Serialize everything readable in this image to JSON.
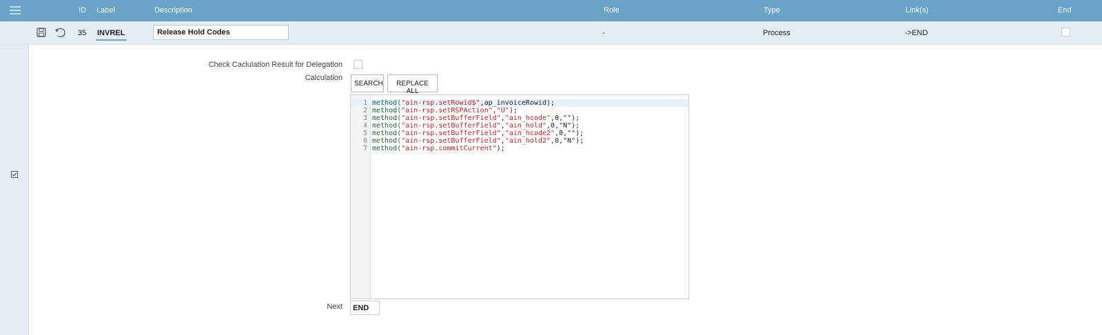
{
  "header": {
    "id": "ID",
    "label": "Label",
    "description": "Description",
    "role": "Role",
    "type": "Type",
    "links": "Link(s)",
    "end": "End"
  },
  "row": {
    "id": "35",
    "label": "INVREL",
    "description": "Release Hold Codes",
    "role": "-",
    "type": "Process",
    "links": "->END",
    "end_checked": false
  },
  "icons": {
    "menu": "hamburger-icon",
    "save": "save-icon",
    "undo": "undo-icon",
    "select": "checkbox-checked-icon"
  },
  "form": {
    "check_delegation_label": "Check Caclulation Result for Delegation",
    "check_delegation_checked": false,
    "calculation_label": "Calculation",
    "search_button": "SEARCH",
    "replace_all_button": "REPLACE ALL",
    "next_label": "Next",
    "next_value": "END"
  },
  "code": [
    {
      "n": "1",
      "fn": "method(",
      "s1": "\"ain-rsp.setRowid$\"",
      "rest": ",ap_invoiceRowid);",
      "s2": "",
      "tail": ""
    },
    {
      "n": "2",
      "fn": "method(",
      "s1": "\"ain-rsp.setRSPAction\"",
      "rest": ",",
      "s2": "\"U\"",
      "tail": ");"
    },
    {
      "n": "3",
      "fn": "method(",
      "s1": "\"ain-rsp.setBufferField\"",
      "rest": ",",
      "s2": "\"ain_hcode\"",
      "tail": ",0,\"\");"
    },
    {
      "n": "4",
      "fn": "method(",
      "s1": "\"ain-rsp.setBufferField\"",
      "rest": ",",
      "s2": "\"ain_hold\"",
      "tail": ",0,\"N\");"
    },
    {
      "n": "5",
      "fn": "method(",
      "s1": "\"ain-rsp.setBufferField\"",
      "rest": ",",
      "s2": "\"ain_hcode2\"",
      "tail": ",0,\"\");"
    },
    {
      "n": "6",
      "fn": "method(",
      "s1": "\"ain-rsp.setBufferField\"",
      "rest": ",",
      "s2": "\"ain_hold2\"",
      "tail": ",0,\"N\");"
    },
    {
      "n": "7",
      "fn": "method(",
      "s1": "\"ain-rsp.commitCurrent\"",
      "rest": ");",
      "s2": "",
      "tail": ""
    }
  ],
  "colors": {
    "header_bg": "#6aa3c8",
    "row_bg": "#e4eef4",
    "keyword": "#1a6b3c",
    "string": "#d21c1c"
  }
}
